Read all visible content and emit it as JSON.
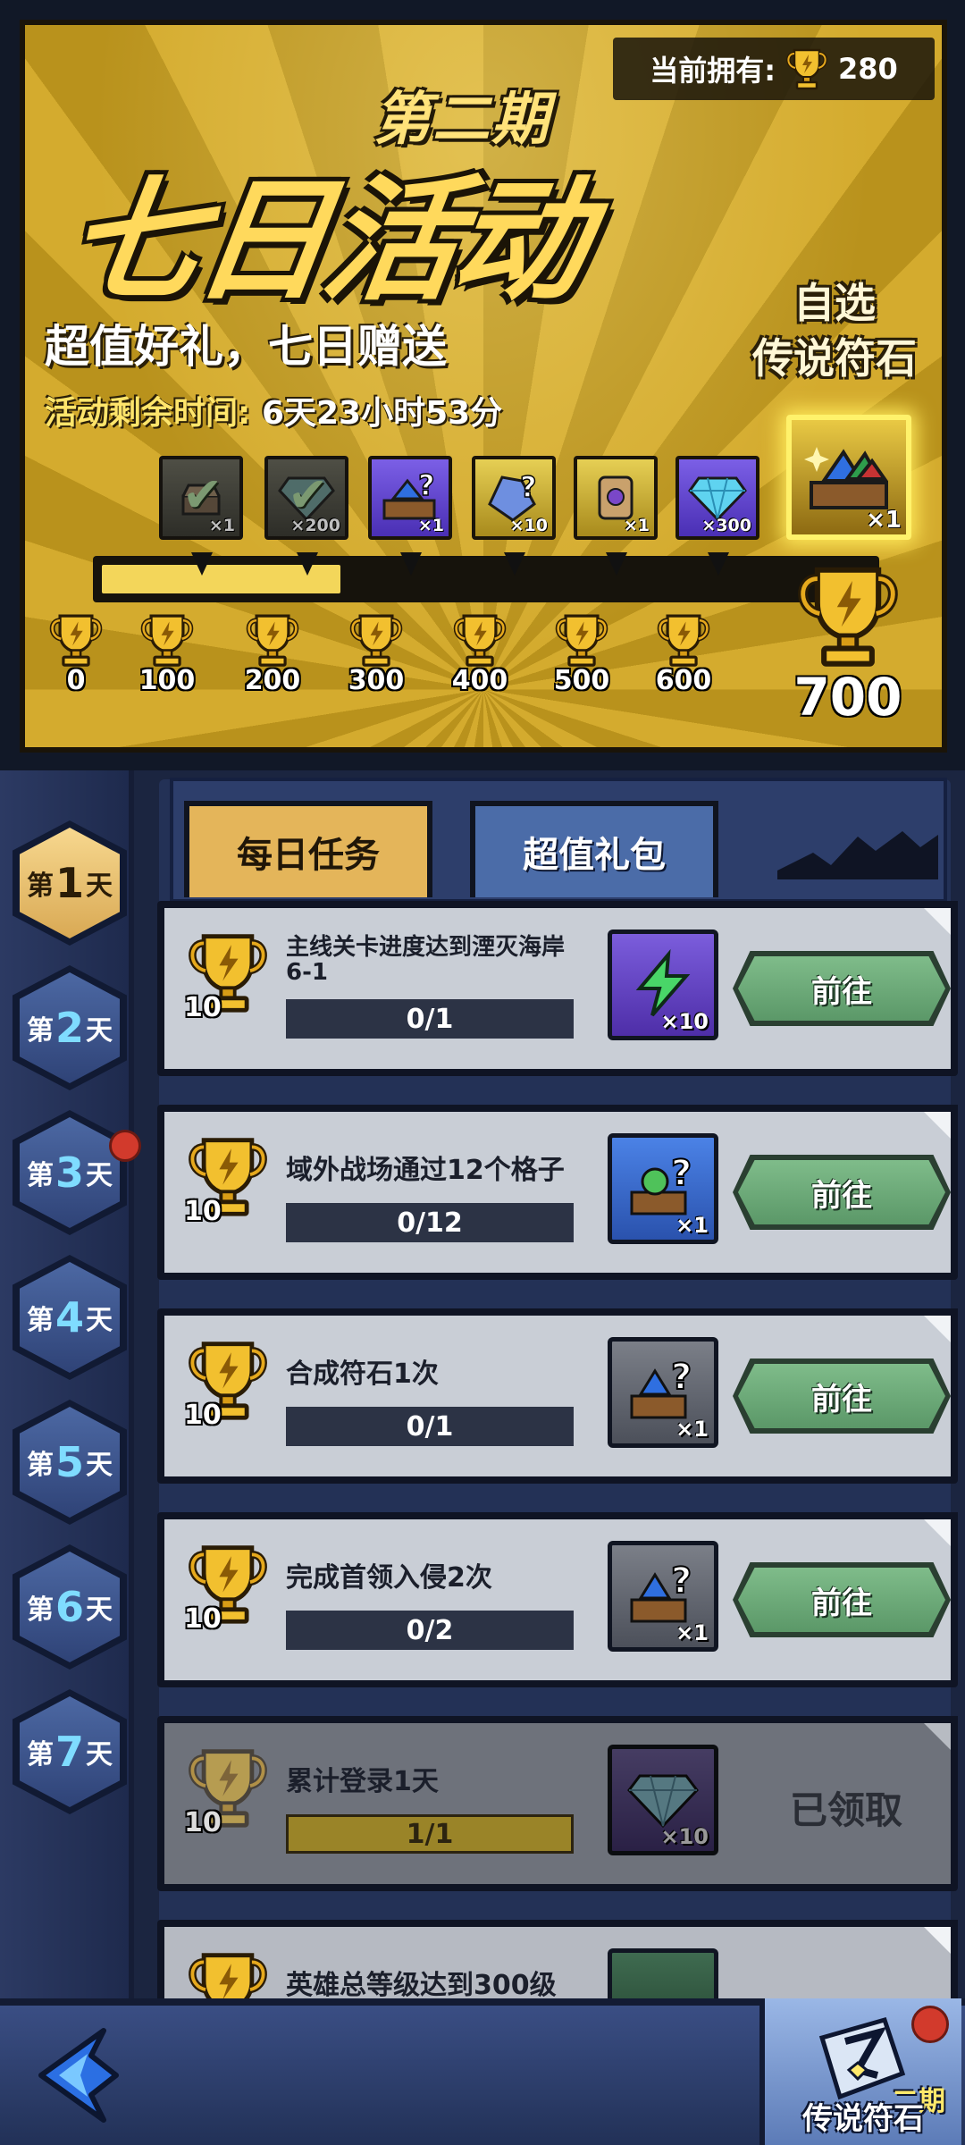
{
  "banner": {
    "owned_label": "当前拥有:",
    "owned_value": "280",
    "title_period": "第二期",
    "title_main": "七日活动",
    "subtitle": "超值好礼，七日赠送",
    "remaining_label": "活动剩余时间:",
    "remaining_value": "6天23小时53分",
    "grand_reward_line1": "自选",
    "grand_reward_line2": "传说符石",
    "progress_fraction": 0.31,
    "rewards": [
      {
        "icon": "chest-item-icon",
        "qty": "×1",
        "claimed": true
      },
      {
        "icon": "gem-icon",
        "qty": "×200",
        "claimed": true
      },
      {
        "icon": "rune-box-icon",
        "qty": "×1",
        "claimed": false
      },
      {
        "icon": "rune-crystal-icon",
        "qty": "×10",
        "claimed": false
      },
      {
        "icon": "scroll-icon",
        "qty": "×1",
        "claimed": false
      },
      {
        "icon": "diamond-icon",
        "qty": "×300",
        "claimed": false
      }
    ],
    "grand_reward_qty": "×1",
    "milestones": [
      "0",
      "100",
      "200",
      "300",
      "400",
      "500",
      "600"
    ],
    "final_milestone": "700"
  },
  "tabs": {
    "daily": "每日任务",
    "packs": "超值礼包"
  },
  "days": [
    "1",
    "2",
    "3",
    "4",
    "5",
    "6",
    "7"
  ],
  "day_prefix": "第",
  "day_suffix": "天",
  "tasks": [
    {
      "name": "主线关卡进度达到湮灭海岸6-1",
      "progress": "0/1",
      "points": "10",
      "reward_qty": "×10",
      "reward_icon": "energy-icon",
      "action": "前往"
    },
    {
      "name": "域外战场通过12个格子",
      "progress": "0/12",
      "points": "10",
      "reward_qty": "×1",
      "reward_icon": "mystery-box-icon",
      "action": "前往"
    },
    {
      "name": "合成符石1次",
      "progress": "0/1",
      "points": "10",
      "reward_qty": "×1",
      "reward_icon": "mystery-rune-icon",
      "action": "前往"
    },
    {
      "name": "完成首领入侵2次",
      "progress": "0/2",
      "points": "10",
      "reward_qty": "×1",
      "reward_icon": "mystery-rune-icon",
      "action": "前往"
    },
    {
      "name": "累计登录1天",
      "progress": "1/1",
      "points": "10",
      "reward_qty": "×10",
      "reward_icon": "diamond-icon",
      "status": "已领取"
    },
    {
      "name": "英雄总等级达到300级",
      "points": "10"
    }
  ],
  "bottom": {
    "legend_button": "传说符石",
    "legend_period": "二期"
  },
  "colors": {
    "gold": "#d4ab2e",
    "go_button": "#6aa878",
    "panel": "#233156",
    "red_dot": "#d23a2c"
  }
}
